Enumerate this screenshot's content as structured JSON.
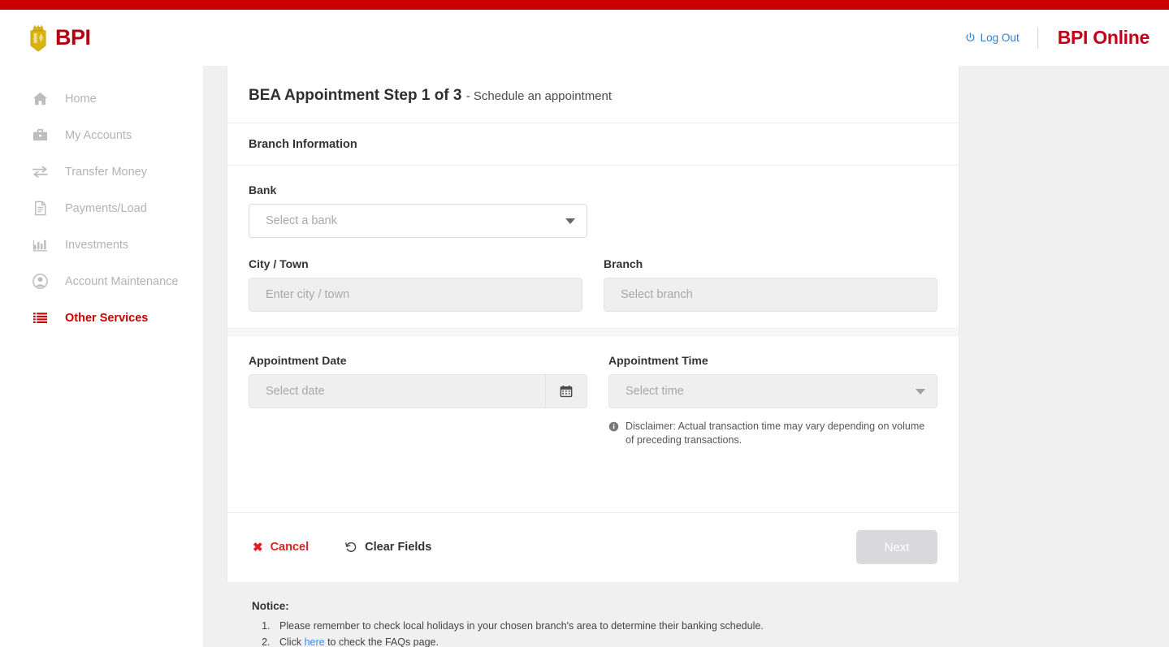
{
  "header": {
    "brand_text": "BPI",
    "brand_icon": "bpi-crest-logo",
    "logout_label": "Log Out",
    "logout_icon": "power-icon",
    "product_name": "BPI Online"
  },
  "sidebar": {
    "items": [
      {
        "label": "Home",
        "icon": "home-icon",
        "key": "home",
        "active": false
      },
      {
        "label": "My Accounts",
        "icon": "briefcase-icon",
        "key": "my-accounts",
        "active": false
      },
      {
        "label": "Transfer Money",
        "icon": "transfer-arrows-icon",
        "key": "transfer-money",
        "active": false
      },
      {
        "label": "Payments/Load",
        "icon": "document-icon",
        "key": "payments-load",
        "active": false
      },
      {
        "label": "Investments",
        "icon": "bar-chart-icon",
        "key": "investments",
        "active": false
      },
      {
        "label": "Account Maintenance",
        "icon": "user-circle-icon",
        "key": "account-maintenance",
        "active": false
      },
      {
        "label": "Other Services",
        "icon": "list-menu-icon",
        "key": "other-services",
        "active": true
      }
    ]
  },
  "main": {
    "title_strong": "BEA Appointment Step 1 of 3",
    "title_sub": "- Schedule an appointment",
    "section_title": "Branch Information",
    "bank": {
      "label": "Bank",
      "placeholder": "Select a bank",
      "value": ""
    },
    "city": {
      "label": "City / Town",
      "placeholder": "Enter city / town",
      "value": ""
    },
    "branch": {
      "label": "Branch",
      "placeholder": "Select branch",
      "value": ""
    },
    "appointment_date": {
      "label": "Appointment Date",
      "placeholder": "Select date",
      "value": "",
      "icon": "calendar-icon"
    },
    "appointment_time": {
      "label": "Appointment Time",
      "placeholder": "Select time",
      "value": ""
    },
    "disclaimer": {
      "icon": "info-icon",
      "text": "Disclaimer: Actual transaction time may vary depending on volume of preceding transactions."
    },
    "footer": {
      "cancel_label": "Cancel",
      "cancel_icon": "x-icon",
      "clear_label": "Clear Fields",
      "clear_icon": "undo-icon",
      "next_label": "Next"
    }
  },
  "notice": {
    "title": "Notice:",
    "items": [
      {
        "text_before": "Please remember to check local holidays in your chosen branch's area to determine their banking schedule.",
        "link": "",
        "text_after": ""
      },
      {
        "text_before": "Click ",
        "link": "here",
        "text_after": " to check the FAQs page."
      }
    ]
  },
  "colors": {
    "brand_red": "#cc0000",
    "link_blue": "#3d8ee0",
    "accent_red": "#e02020",
    "page_bg": "#f0f0f0"
  }
}
